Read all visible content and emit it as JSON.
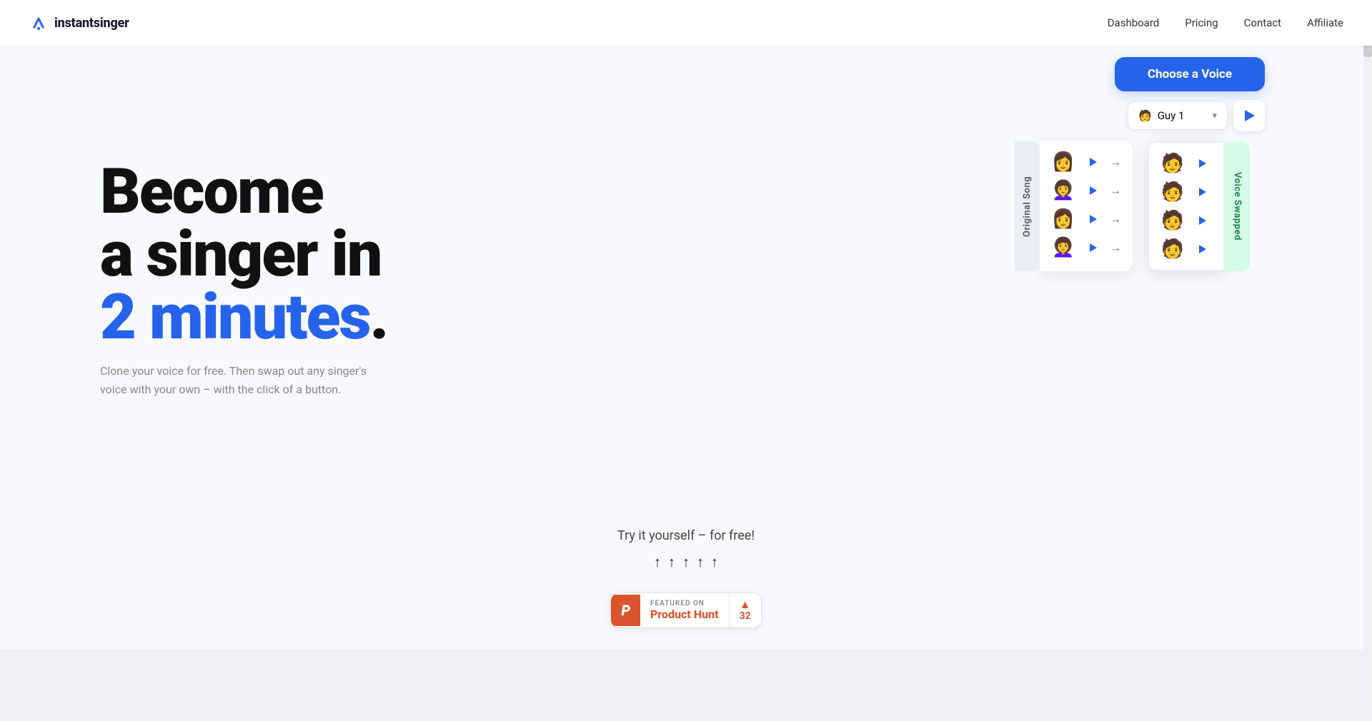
{
  "nav": {
    "logo_text_light": "instant",
    "logo_text_bold": "singer",
    "links": [
      {
        "id": "dashboard",
        "label": "Dashboard",
        "href": "#"
      },
      {
        "id": "pricing",
        "label": "Pricing",
        "href": "#"
      },
      {
        "id": "contact",
        "label": "Contact",
        "href": "#"
      },
      {
        "id": "affiliate",
        "label": "Affiliate",
        "href": "#"
      }
    ]
  },
  "hero": {
    "headline_line1": "Become",
    "headline_line2": "a singer in",
    "headline_line3_plain": "2",
    "headline_line3_blue": "minutes",
    "headline_period": ".",
    "subtext": "Clone your voice for free. Then swap out any singer's voice with your own – with the click of a button."
  },
  "voice_chooser": {
    "title": "Choose a Voice",
    "selected": "Guy 1",
    "selected_emoji": "🧑",
    "dropdown_placeholder": "Guy 1"
  },
  "voice_table": {
    "original_label": "Original Song",
    "swapped_label": "Voice Swapped",
    "rows": [
      {
        "emoji": "👩",
        "id": "row1"
      },
      {
        "emoji": "👩‍🦱",
        "id": "row2"
      },
      {
        "emoji": "👩",
        "id": "row3"
      },
      {
        "emoji": "👩‍🦱",
        "id": "row4"
      }
    ],
    "swapped_rows": [
      {
        "emoji": "🧑",
        "id": "srow1"
      },
      {
        "emoji": "🧑",
        "id": "srow2"
      },
      {
        "emoji": "🧑",
        "id": "srow3"
      },
      {
        "emoji": "🧑",
        "id": "srow4"
      }
    ]
  },
  "try_section": {
    "text": "Try it yourself – for free!",
    "arrows": [
      "↑",
      "↑",
      "↑",
      "↑",
      "↑"
    ]
  },
  "product_hunt": {
    "featured_label": "FEATURED ON",
    "name": "Product Hunt",
    "count": "32",
    "logo_letter": "P"
  }
}
